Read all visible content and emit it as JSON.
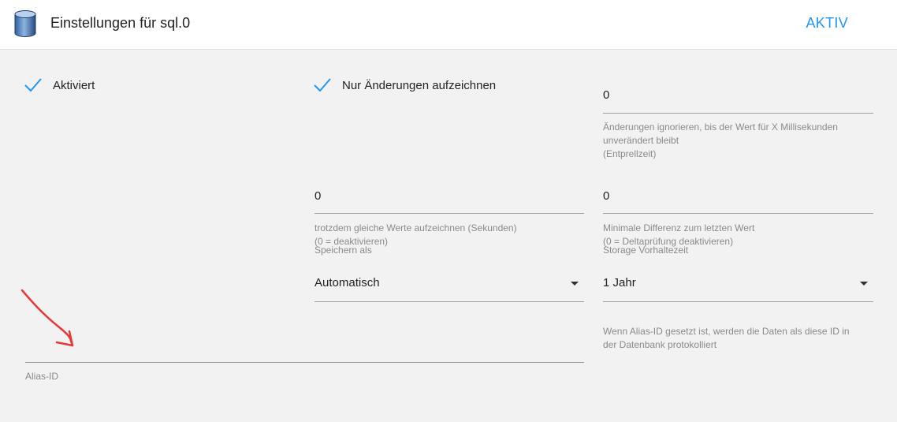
{
  "header": {
    "title": "Einstellungen für sql.0",
    "status": "AKTIV",
    "icon": "database-icon"
  },
  "settings": {
    "enabled": {
      "label": "Aktiviert",
      "checked": true
    },
    "changes_only": {
      "label": "Nur Änderungen aufzeichnen",
      "checked": true
    },
    "debounce": {
      "value": "0",
      "helper_line1": "Änderungen ignorieren, bis der Wert für X Millisekunden",
      "helper_line2": "unverändert bleibt",
      "helper_line3": "(Entprellzeit)"
    },
    "log_same_values": {
      "value": "0",
      "helper_line1": "trotzdem gleiche Werte aufzeichnen (Sekunden)",
      "helper_line2": "(0 = deaktivieren)"
    },
    "min_difference": {
      "value": "0",
      "helper_line1": "Minimale Differenz zum letzten Wert",
      "helper_line2": "(0 = Deltaprüfung deaktivieren)"
    },
    "store_as": {
      "label": "Speichern als",
      "value": "Automatisch"
    },
    "retention": {
      "label": "Storage Vorhaltezeit",
      "value": "1 Jahr"
    },
    "alias_id": {
      "label": "Alias-ID",
      "value": "",
      "helper_line1": "Wenn Alias-ID gesetzt ist, werden die Daten als diese ID in",
      "helper_line2": "der Datenbank protokolliert"
    }
  },
  "colors": {
    "accent": "#2196f3",
    "annotation": "#e53935",
    "background": "#f2f2f2"
  }
}
